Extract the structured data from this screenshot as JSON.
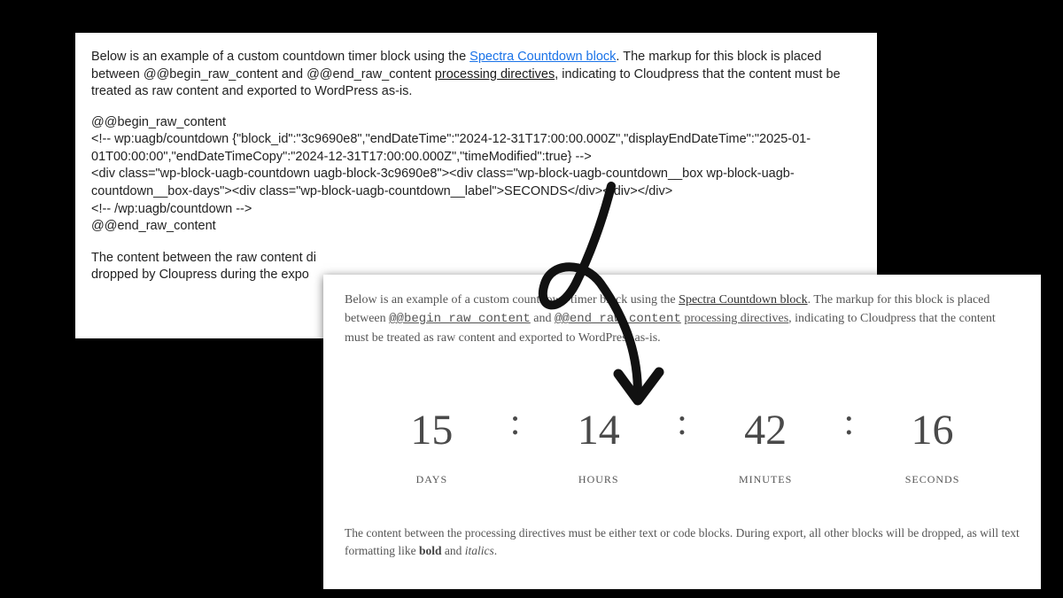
{
  "source": {
    "intro_before_link": "Below is an example of a custom countdown timer block using the ",
    "spectra_link": "Spectra Countdown block",
    "intro_after_link": ". The markup for this block is placed between @@begin_raw_content and @@end_raw_content ",
    "processing_directives_link": "processing directives",
    "intro_tail": ", indicating to Cloudpress that the content must be treated as raw content and exported to WordPress as-is.",
    "code_line1": "@@begin_raw_content",
    "code_line2": "<!-- wp:uagb/countdown {\"block_id\":\"3c9690e8\",\"endDateTime\":\"2024-12-31T17:00:00.000Z\",\"displayEndDateTime\":\"2025-01-01T00:00:00\",\"endDateTimeCopy\":\"2024-12-31T17:00:00.000Z\",\"timeModified\":true} -->",
    "code_line3": "<div class=\"wp-block-uagb-countdown uagb-block-3c9690e8\"><div class=\"wp-block-uagb-countdown__box wp-block-uagb-countdown__box-days\"><div class=\"wp-block-uagb-countdown__label\">SECONDS</div></div></div>",
    "code_line4": "<!-- /wp:uagb/countdown -->",
    "code_line5": "@@end_raw_content",
    "truncated_line1": "The content between the raw content di",
    "truncated_line2": "dropped by Cloupress during the expo"
  },
  "rendered": {
    "intro_before_link": "Below is an example of a custom countdown timer block using the ",
    "spectra_link": "Spectra Countdown block",
    "intro_mid": ". The markup for this block is placed between ",
    "begin_marker": "@@begin_raw_content",
    "and_word": " and ",
    "end_marker": "@@end_raw_content",
    "space": " ",
    "processing_directives_link": "processing directives",
    "intro_tail": ", indicating to Cloudpress that the content must be treated as raw content and exported to WordPress as-is.",
    "countdown": {
      "days": {
        "value": "15",
        "label": "DAYS"
      },
      "hours": {
        "value": "14",
        "label": "HOURS"
      },
      "minutes": {
        "value": "42",
        "label": "MINUTES"
      },
      "seconds": {
        "value": "16",
        "label": "SECONDS"
      },
      "separator": ":"
    },
    "footer_before_bold": "The content between the processing directives must be either text or code blocks. During export, all other blocks will be dropped, as will text formatting like ",
    "footer_bold": "bold",
    "footer_mid": " and ",
    "footer_italics": "italics",
    "footer_end": "."
  }
}
